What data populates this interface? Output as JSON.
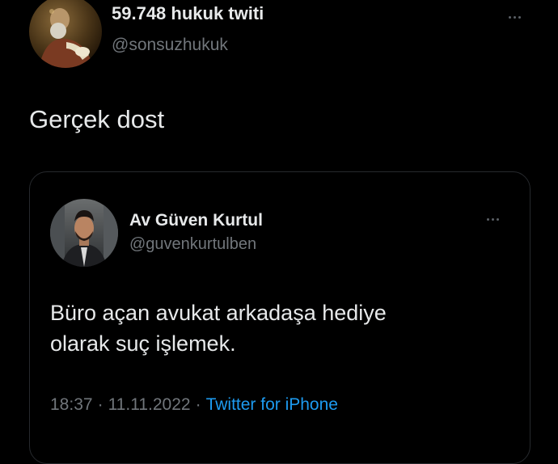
{
  "main_tweet": {
    "author_name": "59.748 hukuk twiti",
    "author_handle": "@sonsuzhukuk",
    "text": "Gerçek dost",
    "avatar_icon": "painting-portrait-avatar"
  },
  "quoted_tweet": {
    "author_name": "Av Güven Kurtul",
    "author_handle": "@guvenkurtulben",
    "text_lines": [
      "Büro açan avukat arkadaşa hediye",
      "olarak suç işlemek."
    ],
    "avatar_icon": "person-photo-avatar",
    "time": "18:37",
    "separator": "·",
    "date": "11.11.2022",
    "source": "Twitter for iPhone"
  },
  "colors": {
    "background": "#000000",
    "primary_text": "#e7e9ea",
    "secondary_text": "#71767b",
    "link": "#1d9bf0",
    "border": "#26292d"
  },
  "icons": {
    "more": "more-options-icon"
  }
}
